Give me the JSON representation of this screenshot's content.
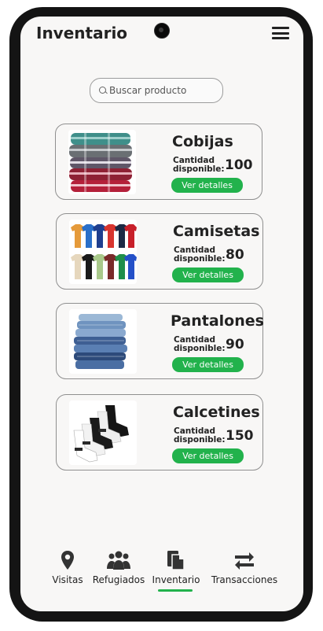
{
  "header": {
    "title": "Inventario"
  },
  "search": {
    "placeholder": "Buscar producto"
  },
  "products": [
    {
      "name": "Cobijas",
      "quantity_label": "Cantidad disponible:",
      "quantity": "100",
      "button": "Ver detalles",
      "icon": "blankets-image"
    },
    {
      "name": "Camisetas",
      "quantity_label": "Cantidad disponible:",
      "quantity": "80",
      "button": "Ver detalles",
      "icon": "tshirts-image"
    },
    {
      "name": "Pantalones",
      "quantity_label": "Cantidad disponible:",
      "quantity": "90",
      "button": "Ver detalles",
      "icon": "jeans-image"
    },
    {
      "name": "Calcetines",
      "quantity_label": "Cantidad disponible:",
      "quantity": "150",
      "button": "Ver detalles",
      "icon": "socks-image"
    }
  ],
  "nav": [
    {
      "label": "Visitas",
      "icon": "location-pin-icon"
    },
    {
      "label": "Refugiados",
      "icon": "people-group-icon"
    },
    {
      "label": "Inventario",
      "icon": "documents-icon",
      "active": true
    },
    {
      "label": "Transacciones",
      "icon": "swap-arrows-icon"
    }
  ],
  "colors": {
    "accent": "#22b24c",
    "text": "#222222",
    "background": "#f8f7f6"
  }
}
